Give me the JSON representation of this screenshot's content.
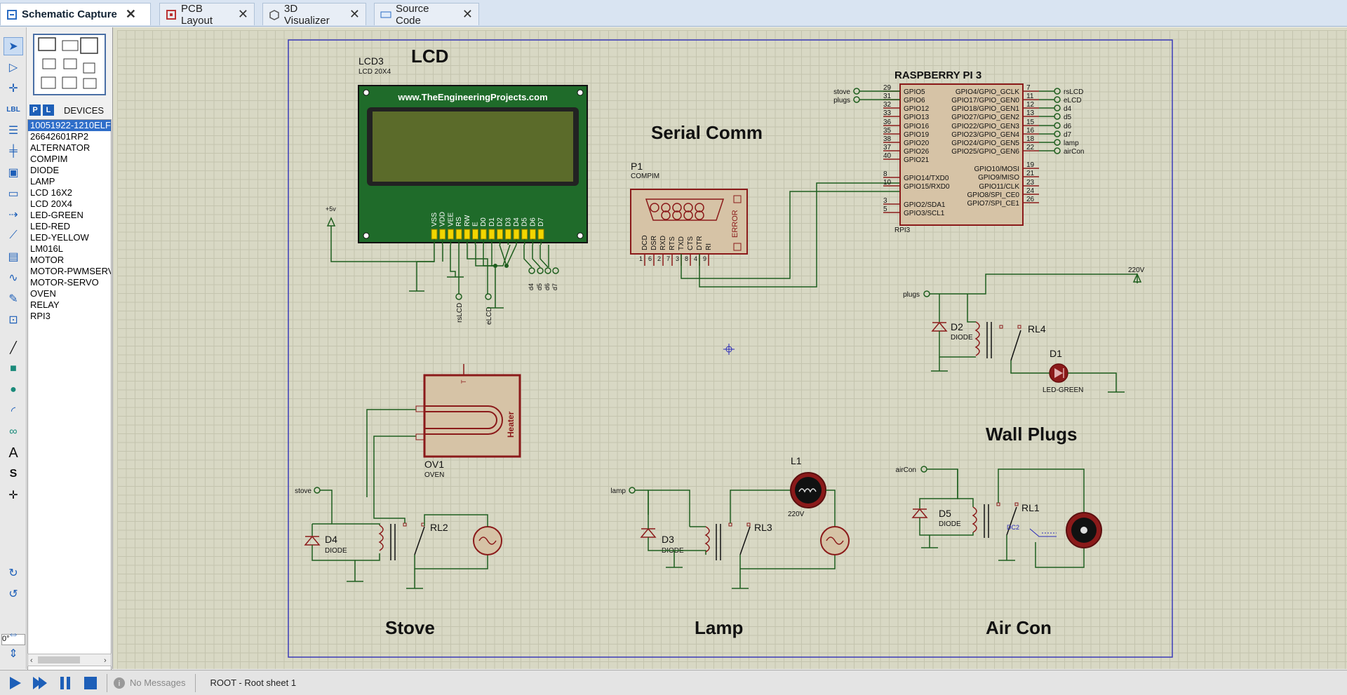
{
  "tabs": [
    {
      "label": "Schematic Capture",
      "active": true
    },
    {
      "label": "PCB Layout",
      "active": false
    },
    {
      "label": "3D Visualizer",
      "active": false
    },
    {
      "label": "Source Code",
      "active": false
    }
  ],
  "device_panel": {
    "btn_p": "P",
    "btn_l": "L",
    "title": "DEVICES",
    "items": [
      "10051922-1210ELF",
      "26642601RP2",
      "ALTERNATOR",
      "COMPIM",
      "DIODE",
      "LAMP",
      "LCD 16X2",
      "LCD 20X4",
      "LED-GREEN",
      "LED-RED",
      "LED-YELLOW",
      "LM016L",
      "MOTOR",
      "MOTOR-PWMSERVO",
      "MOTOR-SERVO",
      "OVEN",
      "RELAY",
      "RPI3"
    ],
    "selected_index": 0
  },
  "rotation": "0°",
  "status": {
    "messages": "No Messages",
    "sheet": "ROOT - Root sheet 1"
  },
  "schematic": {
    "sections": {
      "lcd": "LCD",
      "serial": "Serial Comm",
      "wall": "Wall Plugs",
      "stove": "Stove",
      "lamp": "Lamp",
      "aircon": "Air Con"
    },
    "lcd": {
      "ref": "LCD3",
      "part": "LCD 20X4",
      "banner": "www.TheEngineeringProjects.com",
      "pins": [
        "VSS",
        "VDD",
        "VEE",
        "RS",
        "RW",
        "E",
        "D0",
        "D1",
        "D2",
        "D3",
        "D4",
        "D5",
        "D6",
        "D7"
      ],
      "power": "+5v",
      "rs": "rsLCD",
      "e": "eLCD",
      "d": [
        "d4",
        "d5",
        "d6",
        "d7"
      ]
    },
    "compim": {
      "ref": "P1",
      "part": "COMPIM",
      "error": "ERROR",
      "pins": [
        "DCD",
        "DSR",
        "RXD",
        "RTS",
        "TXD",
        "CTS",
        "DTR",
        "RI"
      ],
      "nums": [
        "1",
        "6",
        "2",
        "7",
        "3",
        "8",
        "4",
        "9"
      ]
    },
    "rpi": {
      "title": "RASPBERRY PI 3",
      "ref": "RPI3",
      "left": [
        {
          "n": "29",
          "l": "GPIO5"
        },
        {
          "n": "31",
          "l": "GPIO6"
        },
        {
          "n": "32",
          "l": "GPIO12"
        },
        {
          "n": "33",
          "l": "GPIO13"
        },
        {
          "n": "36",
          "l": "GPIO16"
        },
        {
          "n": "35",
          "l": "GPIO19"
        },
        {
          "n": "38",
          "l": "GPIO20"
        },
        {
          "n": "37",
          "l": "GPIO26"
        },
        {
          "n": "40",
          "l": "GPIO21"
        },
        {
          "n": "8",
          "l": "GPIO14/TXD0"
        },
        {
          "n": "10",
          "l": "GPIO15/RXD0"
        },
        {
          "n": "3",
          "l": "GPIO2/SDA1"
        },
        {
          "n": "5",
          "l": "GPIO3/SCL1"
        }
      ],
      "right": [
        {
          "n": "7",
          "l": "GPIO4/GPIO_GCLK"
        },
        {
          "n": "11",
          "l": "GPIO17/GPIO_GEN0"
        },
        {
          "n": "12",
          "l": "GPIO18/GPIO_GEN1"
        },
        {
          "n": "13",
          "l": "GPIO27/GPIO_GEN2"
        },
        {
          "n": "15",
          "l": "GPIO22/GPIO_GEN3"
        },
        {
          "n": "16",
          "l": "GPIO23/GPIO_GEN4"
        },
        {
          "n": "18",
          "l": "GPIO24/GPIO_GEN5"
        },
        {
          "n": "22",
          "l": "GPIO25/GPIO_GEN6"
        },
        {
          "n": "19",
          "l": "GPIO10/MOSI"
        },
        {
          "n": "21",
          "l": "GPIO9/MISO"
        },
        {
          "n": "23",
          "l": "GPIO11/CLK"
        },
        {
          "n": "24",
          "l": "GPIO8/SPI_CE0"
        },
        {
          "n": "26",
          "l": "GPIO7/SPI_CE1"
        }
      ],
      "left_nets": [
        "stove",
        "plugs"
      ],
      "right_nets": [
        "rsLCD",
        "eLCD",
        "d4",
        "d5",
        "d6",
        "d7",
        "lamp",
        "airCon"
      ]
    },
    "stove": {
      "net": "stove",
      "diode": "D4",
      "diode_part": "DIODE",
      "relay": "RL2",
      "oven_ref": "OV1",
      "oven_part": "OVEN",
      "heater": "Heater"
    },
    "lamp": {
      "net": "lamp",
      "diode": "D3",
      "diode_part": "DIODE",
      "relay": "RL3",
      "lamp_ref": "L1",
      "voltage": "220V"
    },
    "wall": {
      "net": "plugs",
      "diode": "D2",
      "diode_part": "DIODE",
      "relay": "RL4",
      "led_ref": "D1",
      "led_part": "LED-GREEN",
      "voltage": "220V"
    },
    "aircon": {
      "net": "airCon",
      "diode": "D5",
      "diode_part": "DIODE",
      "relay": "RL1",
      "motor": "DC2"
    }
  }
}
